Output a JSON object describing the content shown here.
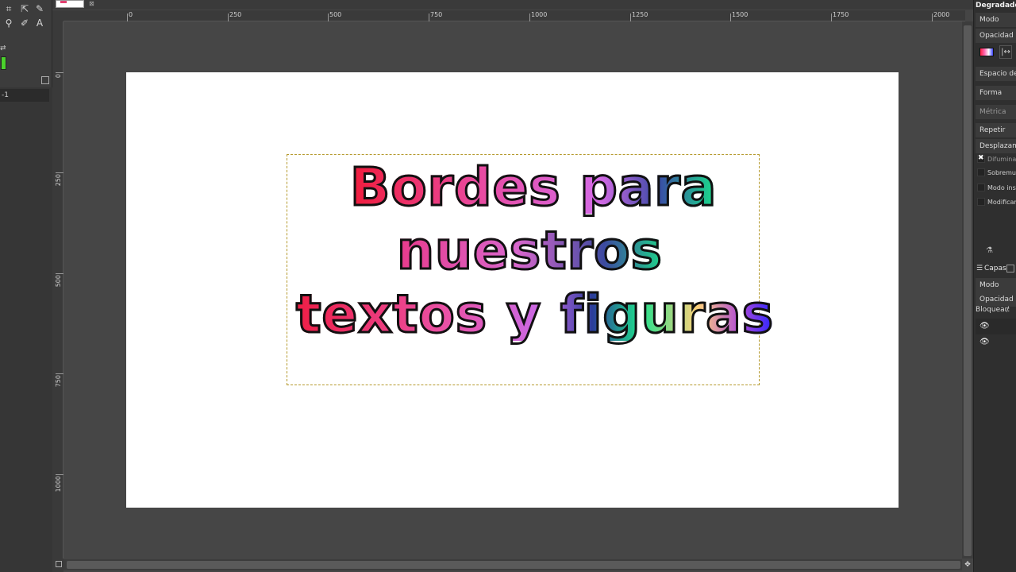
{
  "toolbox": {
    "option_value": "-1",
    "foreground_color": "#4bd12c"
  },
  "image_tab": {
    "thumb_color": "#e04070"
  },
  "rulers": {
    "horizontal_labels": [
      "0",
      "250",
      "500",
      "750",
      "1000",
      "1250",
      "1500",
      "1750",
      "2000"
    ],
    "vertical_labels": [
      "0",
      "250",
      "500",
      "750",
      "1000"
    ]
  },
  "canvas": {
    "text_lines": [
      "Bordes para",
      "nuestros",
      "textos y figuras"
    ],
    "selection_border_color": "#b59a2e"
  },
  "dock": {
    "title": "Degradado",
    "mode_label": "Modo",
    "opacity_label": "Opacidad",
    "color_space_label": "Espacio de c",
    "shape_label": "Forma",
    "metric_label": "Métrica",
    "repeat_label": "Repetir",
    "offset_label": "Desplazamien",
    "checkboxes": [
      "Difuminad",
      "Sobremue",
      "Modo inst",
      "Modificar"
    ],
    "layers_label": "Capas",
    "layers_mode_label": "Modo",
    "layers_opacity_label": "Opacidad",
    "lock_label": "Bloquear:"
  }
}
